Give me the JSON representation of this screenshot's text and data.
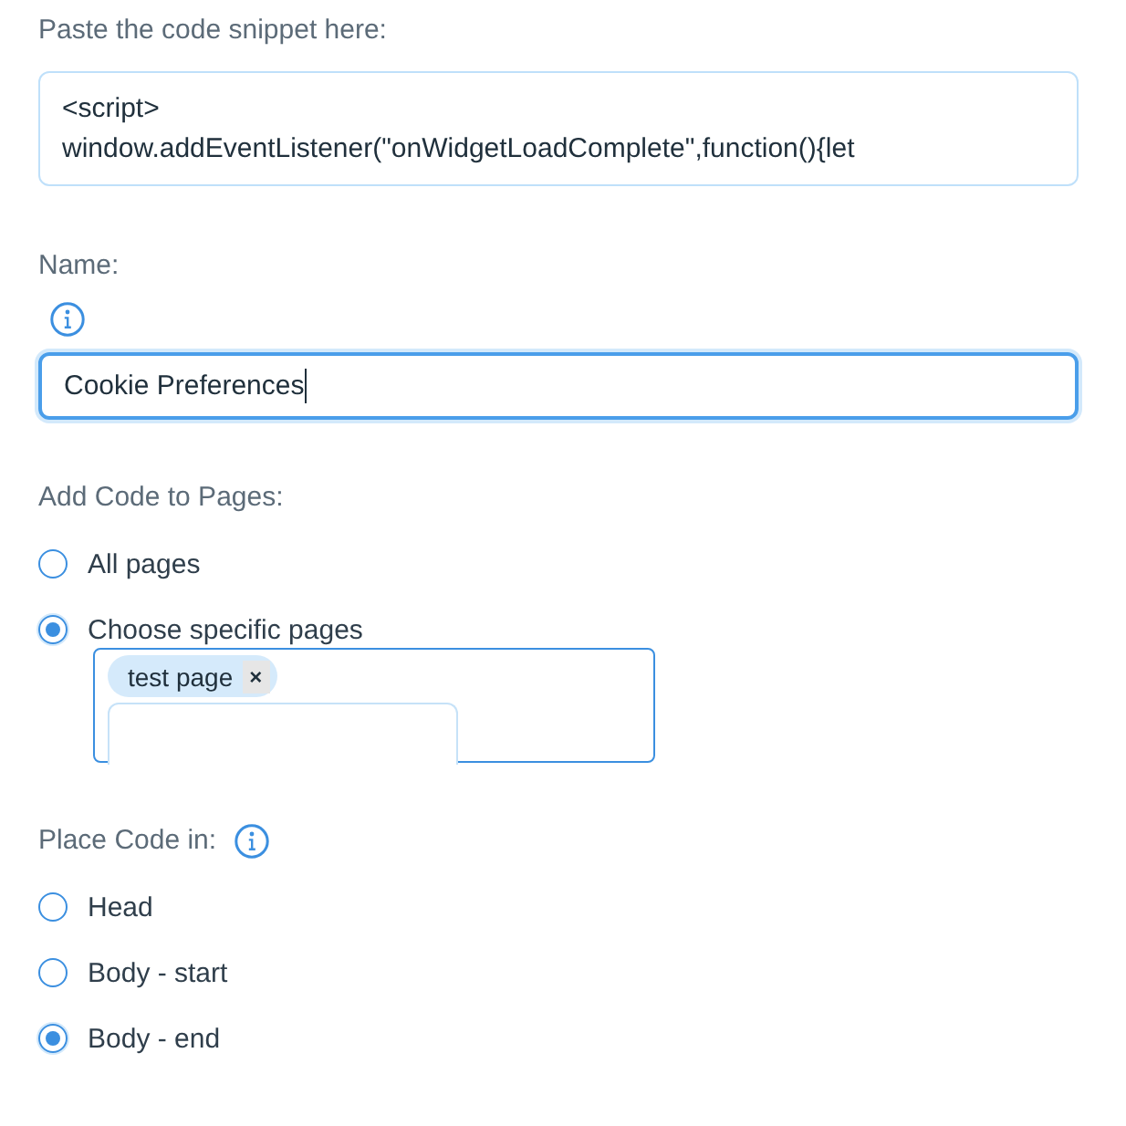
{
  "snippet": {
    "label": "Paste the code snippet here:",
    "lines": [
      "<script>",
      "window.addEventListener(\"onWidgetLoadComplete\",function(){let"
    ]
  },
  "name": {
    "label": "Name:",
    "value": "Cookie Preferences",
    "focused": true
  },
  "pages": {
    "label": "Add Code to Pages:",
    "options": [
      {
        "label": "All pages",
        "selected": false
      },
      {
        "label": "Choose specific pages",
        "selected": true
      }
    ],
    "tags": [
      {
        "label": "test page",
        "remove": "×"
      }
    ]
  },
  "placement": {
    "label": "Place Code in:",
    "options": [
      {
        "label": "Head",
        "selected": false
      },
      {
        "label": "Body - start",
        "selected": false
      },
      {
        "label": "Body - end",
        "selected": true
      }
    ]
  }
}
